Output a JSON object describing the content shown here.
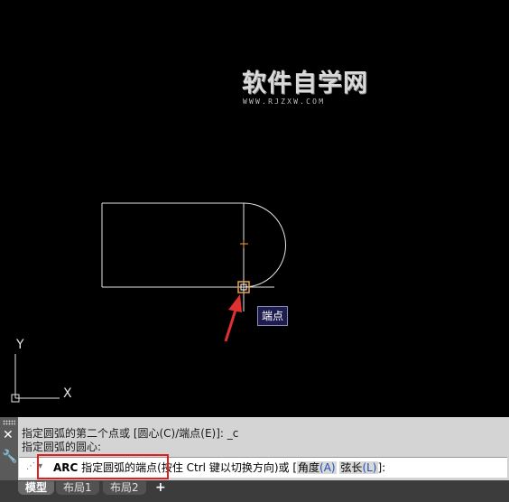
{
  "watermark": {
    "title": "软件自学网",
    "subtitle": "WWW.RJZXW.COM"
  },
  "tooltip": {
    "text": "端点"
  },
  "ucs": {
    "x_label": "X",
    "y_label": "Y"
  },
  "command": {
    "history_line1": "指定圆弧的第二个点或 [圆心(C)/端点(E)]: _c",
    "history_line2": "指定圆弧的圆心:",
    "prompt_cmd": "ARC",
    "prompt_text": " 指定圆弧的端点(按住 Ctrl 键以切换方向)或 [",
    "option1_label": "角度",
    "option1_key": "(A)",
    "option2_label": "弦长",
    "option2_key": "(L)",
    "prompt_end": "]:",
    "close_icon": "close-icon",
    "settings_icon": "wrench-icon"
  },
  "tabs": [
    {
      "label": "模型",
      "active": true
    },
    {
      "label": "布局1",
      "active": false
    },
    {
      "label": "布局2",
      "active": false
    }
  ],
  "add_tab_label": "+",
  "colors": {
    "drawing_lines": "#e6e6e6",
    "snap_marker": "#f0a040",
    "annotation_arrow": "#e03030",
    "highlight_box": "#e02020"
  }
}
